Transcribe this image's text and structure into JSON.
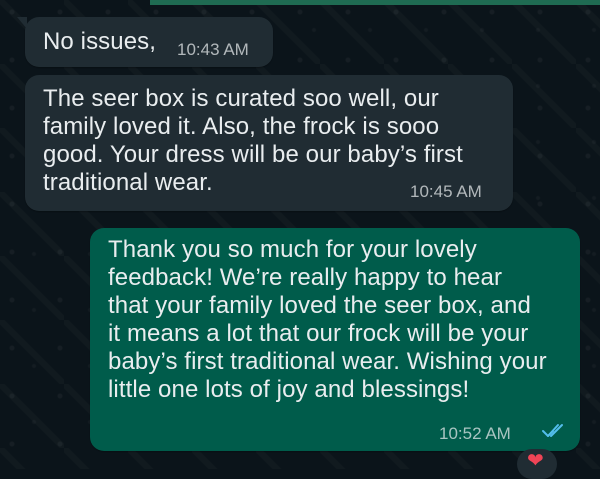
{
  "messages": [
    {
      "text": "No issues,",
      "time": "10:43 AM",
      "direction": "incoming"
    },
    {
      "lines": [
        "The seer box is curated soo well, our",
        "family loved it. Also, the frock is sooo",
        "good. Your dress will be our baby’s first",
        "traditional wear."
      ],
      "time": "10:45 AM",
      "direction": "incoming"
    },
    {
      "lines": [
        "Thank you so much for your lovely",
        "feedback! We’re really happy to hear",
        "that your family loved the seer box, and",
        "it means a lot that our frock will be your",
        "baby’s first traditional wear. Wishing your",
        "little one lots of joy and blessings!"
      ],
      "time": "10:52 AM",
      "direction": "outgoing",
      "status_icon": "read-double-tick-icon"
    }
  ],
  "reaction": {
    "icon": "heart-reaction-icon",
    "glyph": "❤"
  },
  "colors": {
    "background": "#0b141a",
    "incoming_bubble": "#202c33",
    "outgoing_bubble": "#005c4b",
    "read_tick": "#53bdeb",
    "reaction_heart": "#ef4456"
  }
}
